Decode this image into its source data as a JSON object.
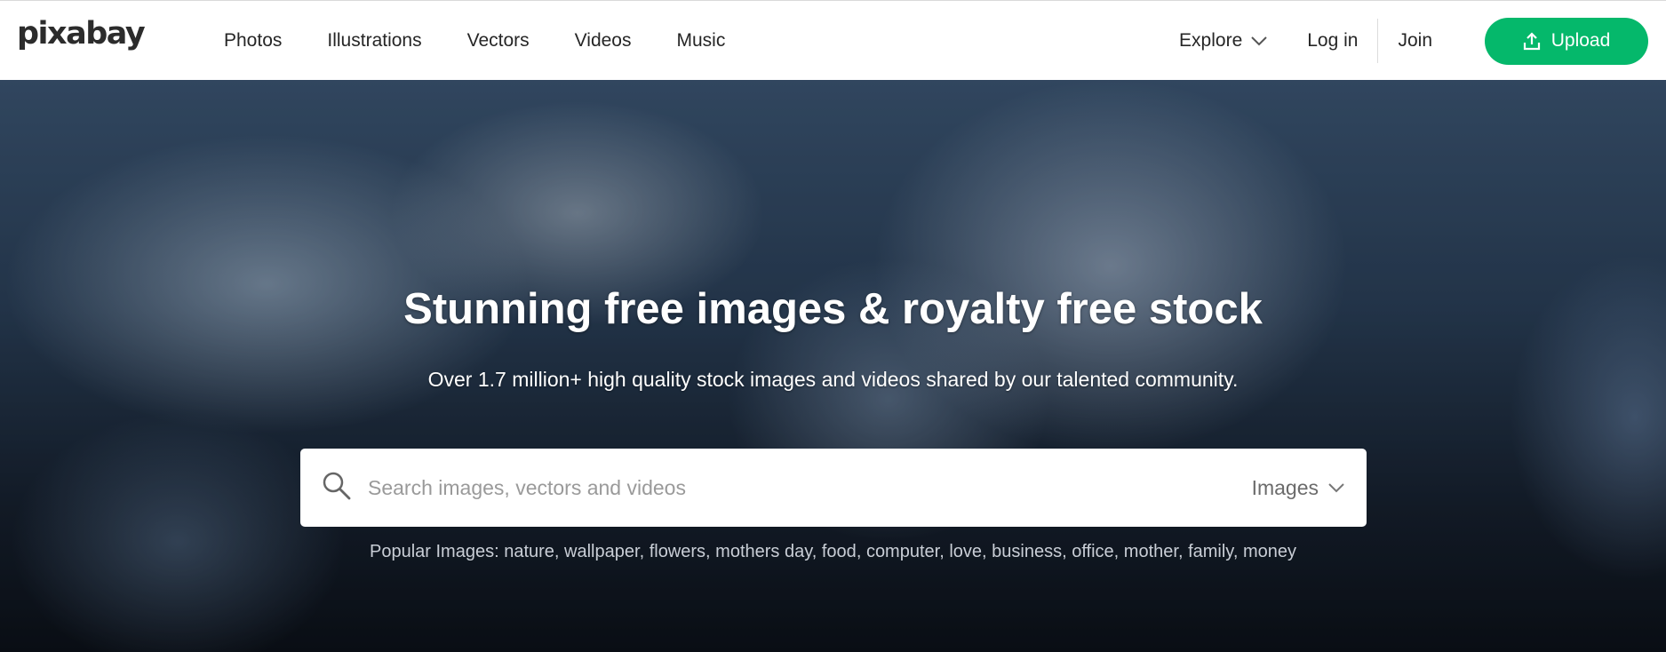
{
  "header": {
    "logo": "pixabay",
    "nav": [
      "Photos",
      "Illustrations",
      "Vectors",
      "Videos",
      "Music"
    ],
    "explore_label": "Explore",
    "login_label": "Log in",
    "join_label": "Join",
    "upload_label": "Upload",
    "upload_color": "#05b86b"
  },
  "hero": {
    "title": "Stunning free images & royalty free stock",
    "subtitle": "Over 1.7 million+ high quality stock images and videos shared by our talented community.",
    "search": {
      "placeholder": "Search images, vectors and videos",
      "type_label": "Images"
    },
    "popular_prefix": "Popular Images:",
    "popular_terms": [
      "nature",
      "wallpaper",
      "flowers",
      "mothers day",
      "food",
      "computer",
      "love",
      "business",
      "office",
      "mother",
      "family",
      "money"
    ]
  },
  "icons": {
    "search": "search-icon",
    "chevron": "chevron-down-icon",
    "upload": "upload-icon"
  }
}
